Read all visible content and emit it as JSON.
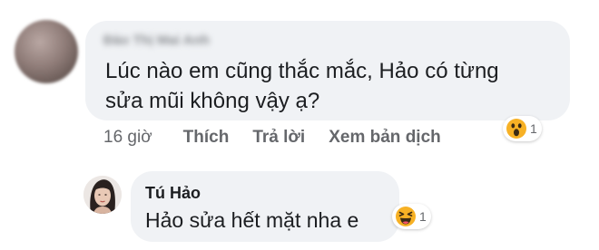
{
  "comment": {
    "author": "Đào Thị Mai Anh",
    "text_line1": "Lúc nào em cũng thắc mắc, Hảo có từng",
    "text_line2": "sửa mũi không vậy ạ?",
    "time": "16 giờ",
    "actions": [
      "Thích",
      "Trả lời",
      "Xem bản dịch"
    ],
    "reaction": {
      "icon": "wow-emoji-icon",
      "count": "1"
    }
  },
  "reply": {
    "author": "Tú Hảo",
    "text": "Hảo sửa hết mặt nha e",
    "reaction": {
      "icon": "haha-emoji-icon",
      "count": "1"
    }
  },
  "colors": {
    "bubble": "#f0f2f5",
    "secondary_text": "#65676b",
    "reaction_yellow": "#f7b125"
  }
}
